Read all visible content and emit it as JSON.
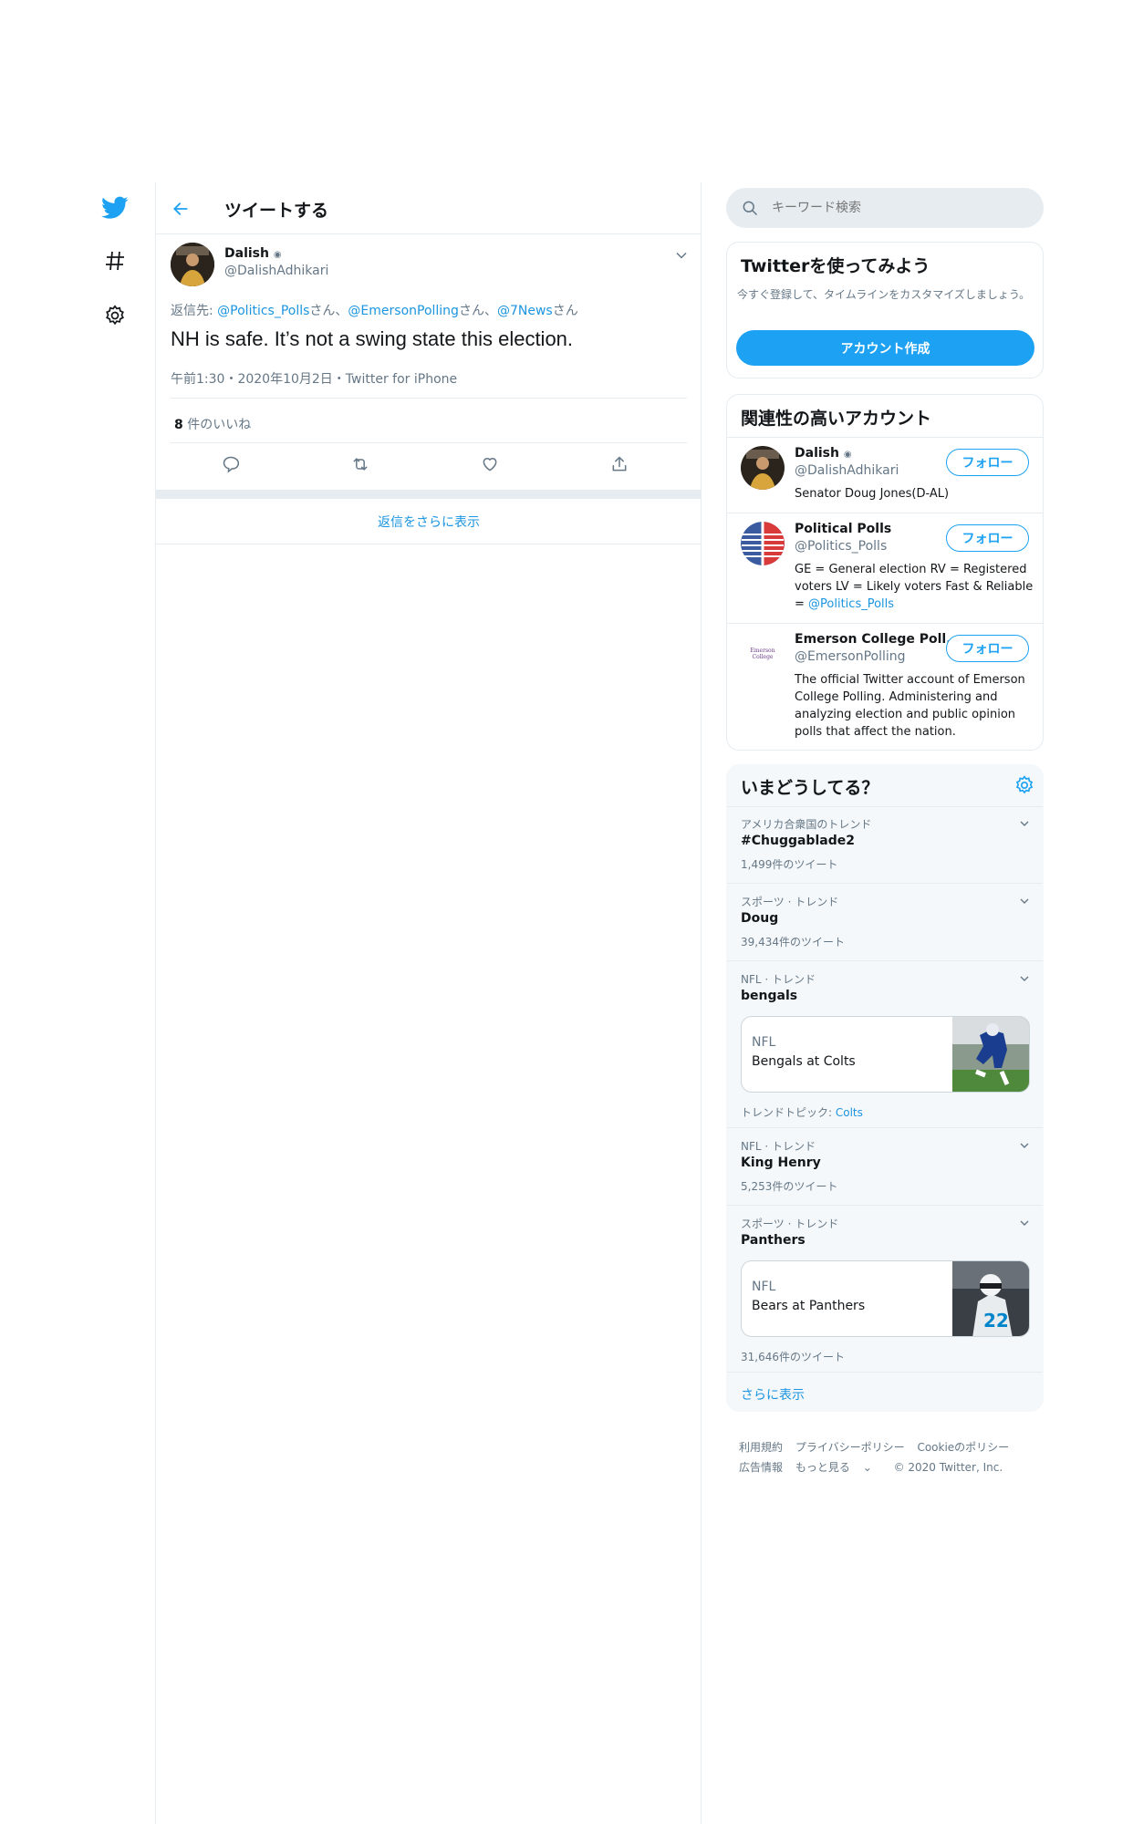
{
  "nav": {
    "icons": [
      "twitter-bird-icon",
      "hashtag-icon",
      "gear-icon"
    ]
  },
  "header": {
    "title": "ツイートする"
  },
  "tweet": {
    "author_name": "Dalish",
    "author_handle": "@DalishAdhikari",
    "reply_prefix": "返信先: ",
    "reply_mentions": [
      "@Politics_Polls",
      "@EmersonPolling",
      "@7News"
    ],
    "mention_suffix": "さん",
    "mention_separator": "、",
    "text": "NH is safe. It’s not a swing state this election.",
    "timestamp": "午前1:30・2020年10月2日・Twitter for iPhone",
    "like_count": "8",
    "like_label": " 件のいいね"
  },
  "more_replies": "返信をさらに表示",
  "search": {
    "placeholder": "キーワード検索"
  },
  "signup": {
    "title": "Twitterを使ってみよう",
    "description": "今すぐ登録して、タイムラインをカスタマイズしましょう。",
    "button": "アカウント作成"
  },
  "related": {
    "title": "関連性の高いアカウント",
    "accounts": [
      {
        "name": "Dalish",
        "handle": "@DalishAdhikari",
        "bio": "Senator Doug Jones(D-AL)",
        "follow": "フォロー"
      },
      {
        "name": "Political Polls",
        "handle": "@Politics_Polls",
        "bio_prefix": "GE = General election RV = Registered voters LV = Likely voters Fast & Reliable = ",
        "bio_link": "@Politics_Polls",
        "follow": "フォロー"
      },
      {
        "name": "Emerson College Poll...",
        "handle": "@EmersonPolling",
        "bio": "The official Twitter account of Emerson College Polling. Administering and analyzing election and public opinion polls that affect the nation.",
        "follow": "フォロー",
        "avatar_text": "Emerson College"
      }
    ]
  },
  "trends": {
    "title": "いまどうしてる？",
    "items": [
      {
        "category": "アメリカ合衆国のトレンド",
        "name": "#Chuggablade2",
        "count": "1,499件のツイート"
      },
      {
        "category": "スポーツ · トレンド",
        "name": "Doug",
        "count": "39,434件のツイート"
      },
      {
        "category": "NFL · トレンド",
        "name": "bengals",
        "event_category": "NFL",
        "event_title": "Bengals at Colts",
        "topic_label": "トレンドトピック: ",
        "topic_link": "Colts"
      },
      {
        "category": "NFL · トレンド",
        "name": "King Henry",
        "count": "5,253件のツイート"
      },
      {
        "category": "スポーツ · トレンド",
        "name": "Panthers",
        "event_category": "NFL",
        "event_title": "Bears at Panthers",
        "count": "31,646件のツイート"
      }
    ],
    "show_more": "さらに表示"
  },
  "footer": {
    "row1": [
      "利用規約",
      "プライバシーポリシー",
      "Cookieのポリシー"
    ],
    "row2": [
      "広告情報",
      "もっと見る",
      "© 2020 Twitter, Inc."
    ]
  },
  "colors": {
    "accent": "#1da1f2",
    "link": "#1b95e0",
    "muted": "#657786",
    "border": "#e6ecf0"
  }
}
